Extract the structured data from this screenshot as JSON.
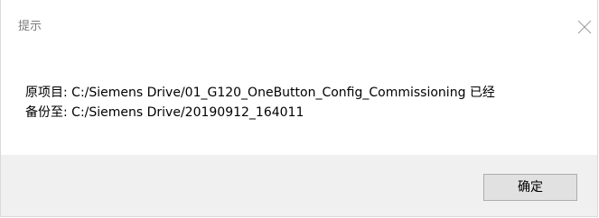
{
  "dialog": {
    "title": "提示",
    "message_line1": "原项目: C:/Siemens Drive/01_G120_OneButton_Config_Commissioning 已经",
    "message_line2": "备份至: C:/Siemens Drive/20190912_164011",
    "ok_label": "确定",
    "close_icon": "close-icon"
  }
}
